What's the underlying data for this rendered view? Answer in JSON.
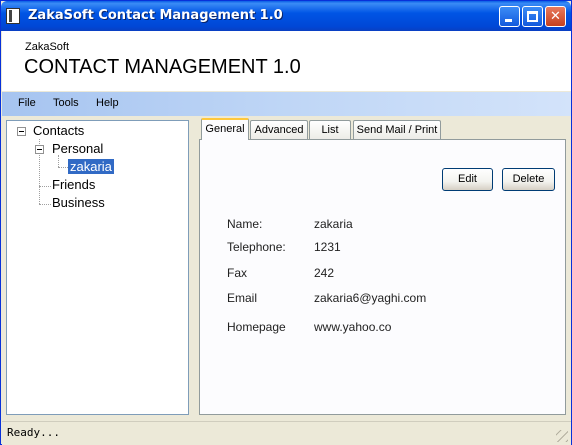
{
  "window": {
    "title": "ZakaSoft Contact Management 1.0",
    "controls": {
      "minimize": "_",
      "maximize": "□",
      "close": "✕"
    }
  },
  "header": {
    "brand": "ZakaSoft",
    "product": "CONTACT MANAGEMENT 1.0"
  },
  "menu": [
    "File",
    "Tools",
    "Help"
  ],
  "tree": {
    "root": "Contacts",
    "groups": [
      {
        "label": "Personal",
        "children": [
          "zakaria"
        ]
      },
      {
        "label": "Friends"
      },
      {
        "label": "Business"
      }
    ],
    "selected": "zakaria"
  },
  "tabs": [
    "General",
    "Advanced",
    "List",
    "Send Mail / Print"
  ],
  "active_tab": "General",
  "buttons": {
    "edit": "Edit",
    "delete": "Delete"
  },
  "fields": [
    {
      "label": "Name:",
      "value": "zakaria"
    },
    {
      "label": "Telephone:",
      "value": "1231"
    },
    {
      "label": "Fax",
      "value": "242"
    },
    {
      "label": "Email",
      "value": "zakaria6@yaghi.com"
    },
    {
      "label": "Homepage",
      "value": "www.yahoo.co"
    }
  ],
  "status": "Ready...",
  "colors": {
    "titlebar": "#0055E5",
    "menubar": "#BFD6F6",
    "selection": "#316AC5",
    "active_tab_accent": "#FFC83C"
  }
}
